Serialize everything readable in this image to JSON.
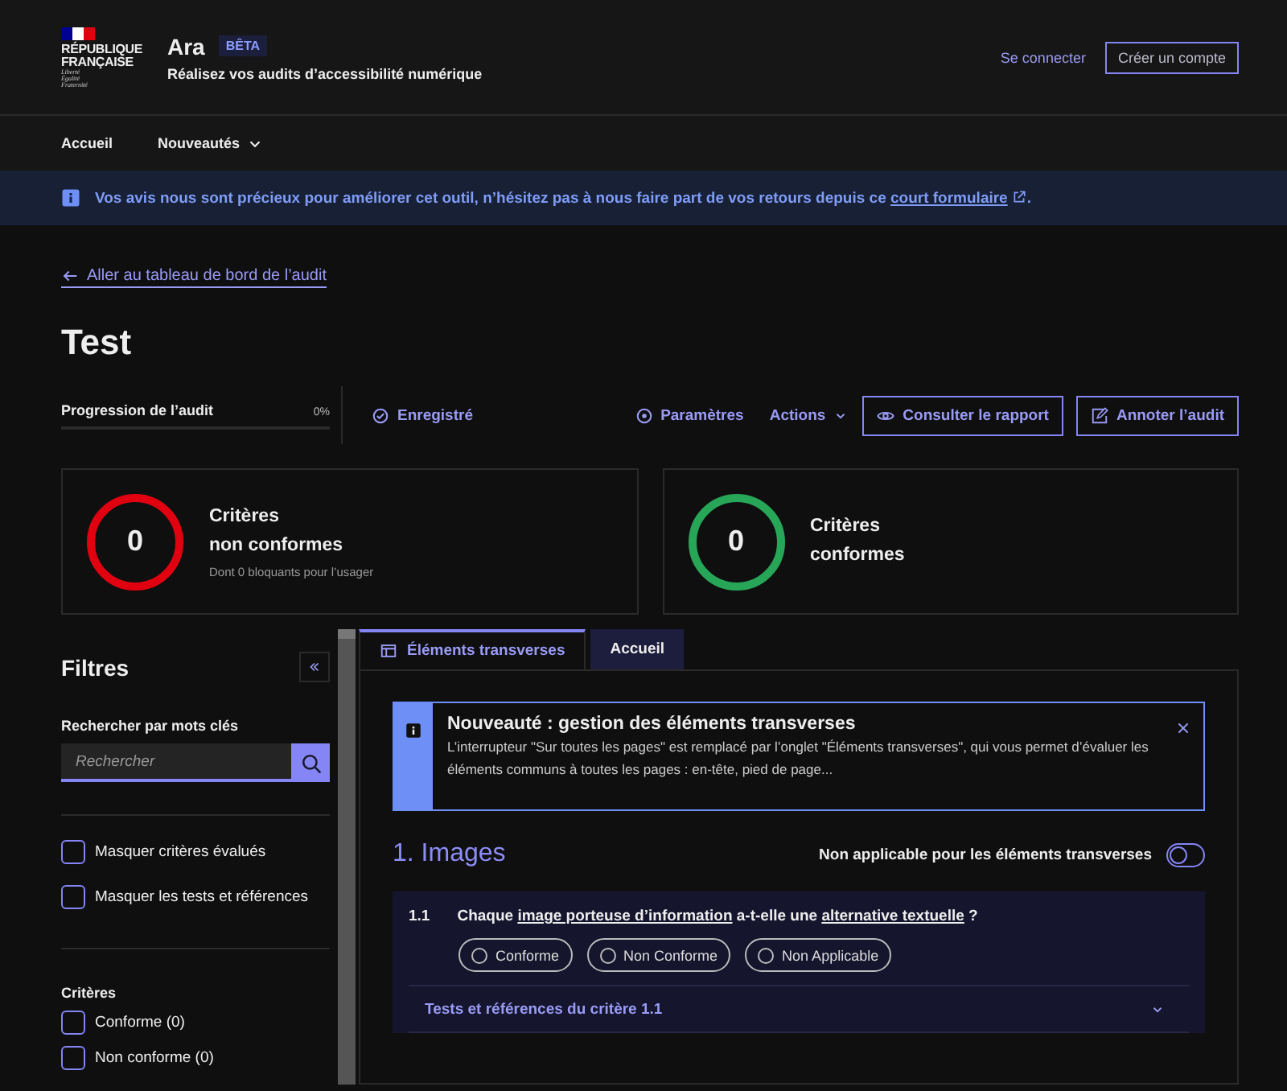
{
  "header": {
    "logo": {
      "line_1": "RÉPUBLIQUE",
      "line_2": "FRANÇAISE",
      "motto": [
        "Liberté",
        "Égalité",
        "Fraternité"
      ]
    },
    "service": "Ara",
    "badge": "BÊTA",
    "tagline": "Réalisez vos audits d’accessibilité numérique",
    "links": [
      {
        "label": "Se connecter",
        "kind": "link"
      },
      {
        "label": "Créer un compte",
        "kind": "button"
      }
    ]
  },
  "nav": [
    {
      "label": "Accueil",
      "dropdown": false
    },
    {
      "label": "Nouveautés",
      "dropdown": true
    }
  ],
  "notice": {
    "text": "Vos avis nous sont précieux pour améliorer cet outil, n’hésitez pas à nous faire part de vos retours depuis ce",
    "link": "court formulaire",
    "end": "."
  },
  "back_link": "Aller au tableau de bord de l’audit",
  "title": "Test",
  "progress": {
    "label": "Progression de l’audit",
    "value": "0%",
    "level": 0
  },
  "toolbar": [
    {
      "label": "Enregistré",
      "kind": "status"
    },
    {
      "label": "Paramètres",
      "kind": "link"
    },
    {
      "label": "Actions",
      "kind": "menu"
    },
    {
      "label": "Consulter le rapport",
      "kind": "button"
    },
    {
      "label": "Annoter l’audit",
      "kind": "button"
    }
  ],
  "summary": [
    {
      "count": "0",
      "title": [
        "Critères",
        "non conformes"
      ],
      "subtitle": "Dont 0 bloquants pour l’usager",
      "color": "#e1000f"
    },
    {
      "count": "0",
      "title": [
        "Critères",
        "conformes"
      ],
      "color": "#27a658"
    }
  ],
  "filters": {
    "title": "Filtres",
    "search_label": "Rechercher par mots clés",
    "placeholder": "Rechercher",
    "toggles": [
      {
        "label": "Masquer critères évalués",
        "checked": false
      },
      {
        "label": "Masquer les tests et références",
        "checked": false
      }
    ],
    "criteria_title": "Critères",
    "criteria": [
      {
        "label": "Conforme (0)",
        "checked": false
      },
      {
        "label": "Non conforme (0)",
        "checked": false
      }
    ]
  },
  "tabs": [
    {
      "label": "Éléments transverses",
      "selected": true
    },
    {
      "label": "Accueil",
      "selected": false
    }
  ],
  "alert": {
    "title": "Nouveauté : gestion des éléments transverses",
    "body": "L’interrupteur \"Sur toutes les pages\" est remplacé par l’onglet \"Éléments transverses\", qui vous permet d’évaluer les éléments communs à toutes les pages : en-tête, pied de page..."
  },
  "topic": {
    "title": "1. Images",
    "switch_label": "Non applicable pour les éléments transverses",
    "switch_on": false
  },
  "criterion": {
    "number": "1.1",
    "question": [
      {
        "kind": "text",
        "text": "Chaque"
      },
      {
        "kind": "link",
        "text": "image porteuse d’information"
      },
      {
        "kind": "text",
        "text": "a-t-elle une"
      },
      {
        "kind": "link",
        "text": "alternative textuelle"
      },
      {
        "kind": "text",
        "text": "?"
      }
    ],
    "options": [
      {
        "label": "Conforme",
        "selected": false
      },
      {
        "label": "Non Conforme",
        "selected": false
      },
      {
        "label": "Non Applicable",
        "selected": false
      }
    ],
    "details": "Tests et références du critère 1.1",
    "expanded": false
  }
}
